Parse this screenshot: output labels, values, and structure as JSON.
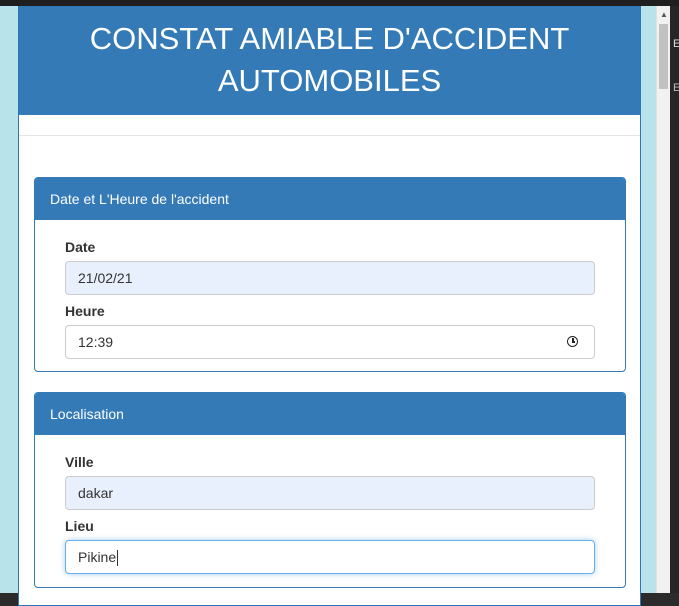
{
  "header": {
    "title_line1": "CONSTAT AMIABLE D'ACCIDENT",
    "title_line2": "AUTOMOBILES"
  },
  "panels": [
    {
      "heading": "Date et L'Heure de l'accident",
      "fields": [
        {
          "label": "Date",
          "value": "21/02/21"
        },
        {
          "label": "Heure",
          "value": "12:39",
          "icon": "clock-icon"
        }
      ]
    },
    {
      "heading": "Localisation",
      "fields": [
        {
          "label": "Ville",
          "value": "dakar"
        },
        {
          "label": "Lieu",
          "value": "Pikine"
        }
      ]
    }
  ],
  "edge": {
    "letter1": "E",
    "letter2": "E"
  },
  "colors": {
    "primary": "#337ab7",
    "autofill": "#e8f0fe",
    "background": "#b9e3ea"
  }
}
